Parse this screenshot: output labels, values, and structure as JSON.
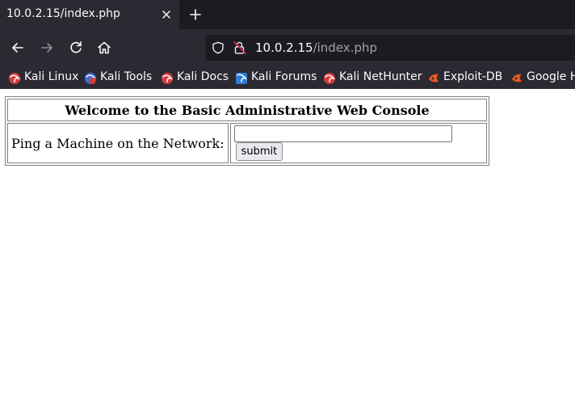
{
  "tab": {
    "title": "10.0.2.15/index.php",
    "close_icon": "close-icon",
    "new_tab_icon": "plus-icon"
  },
  "nav": {
    "back_icon": "arrow-left-icon",
    "forward_icon": "arrow-right-icon",
    "reload_icon": "reload-icon",
    "home_icon": "home-icon",
    "url_host": "10.0.2.15",
    "url_path": "/index.php"
  },
  "bookmarks": [
    {
      "label": "Kali Linux",
      "icon": "kali-icon"
    },
    {
      "label": "Kali Tools",
      "icon": "kali-tools-icon"
    },
    {
      "label": "Kali Docs",
      "icon": "kali-icon"
    },
    {
      "label": "Kali Forums",
      "icon": "kali-forums-icon"
    },
    {
      "label": "Kali NetHunter",
      "icon": "kali-icon"
    },
    {
      "label": "Exploit-DB",
      "icon": "exploit-db-icon"
    },
    {
      "label": "Google Hacking DB",
      "icon": "exploit-db-icon"
    }
  ],
  "page": {
    "heading": "Welcome to the Basic Administrative Web Console",
    "ping_label": "Ping a Machine on the Network:",
    "ping_value": "",
    "submit_label": "submit"
  },
  "colors": {
    "chrome_dark": "#1c1b22",
    "chrome": "#2b2a33",
    "kali_red": "#d73c3c",
    "exploit_orange": "#e8581c"
  }
}
